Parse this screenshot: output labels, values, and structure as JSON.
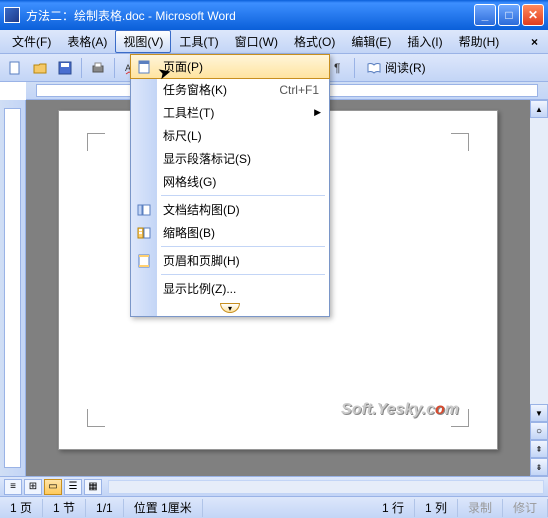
{
  "titlebar": {
    "document_title": "方法二：绘制表格.doc - Microsoft Word"
  },
  "menubar": {
    "items": [
      {
        "label": "文件(F)",
        "hotkey": "F"
      },
      {
        "label": "表格(A)",
        "hotkey": "A"
      },
      {
        "label": "视图(V)",
        "hotkey": "V",
        "active": true
      },
      {
        "label": "工具(T)",
        "hotkey": "T"
      },
      {
        "label": "窗口(W)",
        "hotkey": "W"
      },
      {
        "label": "格式(O)",
        "hotkey": "O"
      },
      {
        "label": "编辑(E)",
        "hotkey": "E"
      },
      {
        "label": "插入(I)",
        "hotkey": "I"
      },
      {
        "label": "帮助(H)",
        "hotkey": "H"
      }
    ]
  },
  "dropdown": {
    "items": [
      {
        "icon": "page-layout-icon",
        "label": "页面(P)",
        "highlighted": true
      },
      {
        "icon": null,
        "label": "任务窗格(K)",
        "shortcut": "Ctrl+F1"
      },
      {
        "icon": null,
        "label": "工具栏(T)",
        "submenu": true
      },
      {
        "icon": null,
        "label": "标尺(L)"
      },
      {
        "icon": null,
        "label": "显示段落标记(S)"
      },
      {
        "icon": null,
        "label": "网格线(G)"
      },
      {
        "sep": true
      },
      {
        "icon": "doc-map-icon",
        "label": "文档结构图(D)"
      },
      {
        "icon": "thumbnails-icon",
        "label": "缩略图(B)"
      },
      {
        "sep": true
      },
      {
        "icon": "header-footer-icon",
        "label": "页眉和页脚(H)"
      },
      {
        "sep": true
      },
      {
        "icon": null,
        "label": "显示比例(Z)..."
      }
    ]
  },
  "toolbar": {
    "reading_label": "阅读(R)"
  },
  "watermark": {
    "prefix": "Soft.Yesky.c",
    "o": "o",
    "suffix": "m"
  },
  "statusbar": {
    "page": "1 页",
    "section": "1 节",
    "page_of": "1/1",
    "position": "位置 1厘米",
    "line": "1 行",
    "column": "1 列",
    "rec": "录制",
    "rev": "修订"
  }
}
